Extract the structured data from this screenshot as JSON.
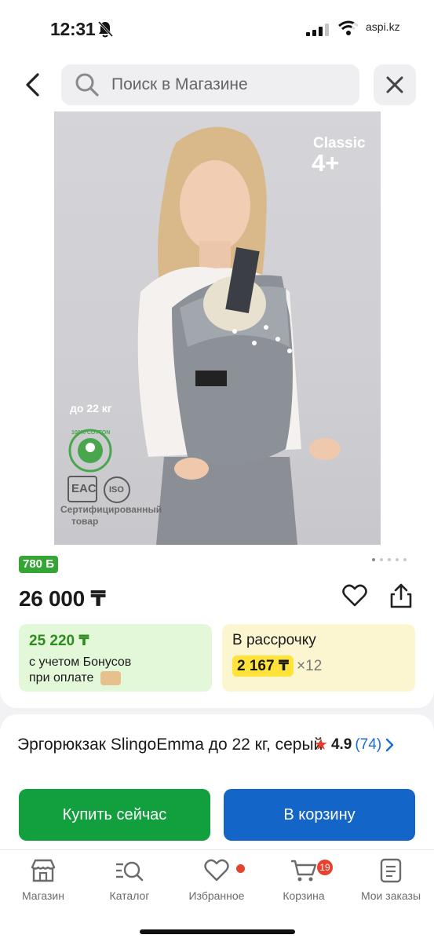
{
  "status_bar": {
    "time": "12:31",
    "site": "aspi.kz"
  },
  "search": {
    "placeholder": "Поиск в Магазине"
  },
  "photo": {
    "badge_line1": "Classic",
    "badge_line2": "4+",
    "weight_text": "до 22 кг",
    "cotton_text": "100% COTTON",
    "eac_text": "EAC",
    "iso_text": "ISO",
    "certified_line1": "Сертифицированный",
    "certified_line2": "товар"
  },
  "product": {
    "bonus_badge": "780 Б",
    "price": "26 000 ₸",
    "title": "Эргорюкзак SlingoEmma до 22 кг, серый",
    "rating": "4.9",
    "reviews": "(74)"
  },
  "offers": {
    "bonus_price": "25 220 ₸",
    "bonus_line1": "с учетом Бонусов",
    "bonus_line2": "при оплате",
    "credit_label": "В рассрочку",
    "credit_amount": "2 167 ₸",
    "credit_multiplier": "×12"
  },
  "actions": {
    "buy_now": "Купить сейчас",
    "add_to_cart": "В корзину"
  },
  "tabbar": {
    "items": [
      {
        "label": "Магазин",
        "icon": "store-icon"
      },
      {
        "label": "Каталог",
        "icon": "catalog-search-icon"
      },
      {
        "label": "Избранное",
        "icon": "heart-icon"
      },
      {
        "label": "Корзина",
        "icon": "cart-icon",
        "badge": "19"
      },
      {
        "label": "Мои заказы",
        "icon": "orders-icon"
      }
    ]
  },
  "colors": {
    "green_button": "#12a03e",
    "blue_button": "#1365c8",
    "bonus_green": "#35a535",
    "credit_yellow": "#ffe23a",
    "badge_red": "#e8412e"
  }
}
